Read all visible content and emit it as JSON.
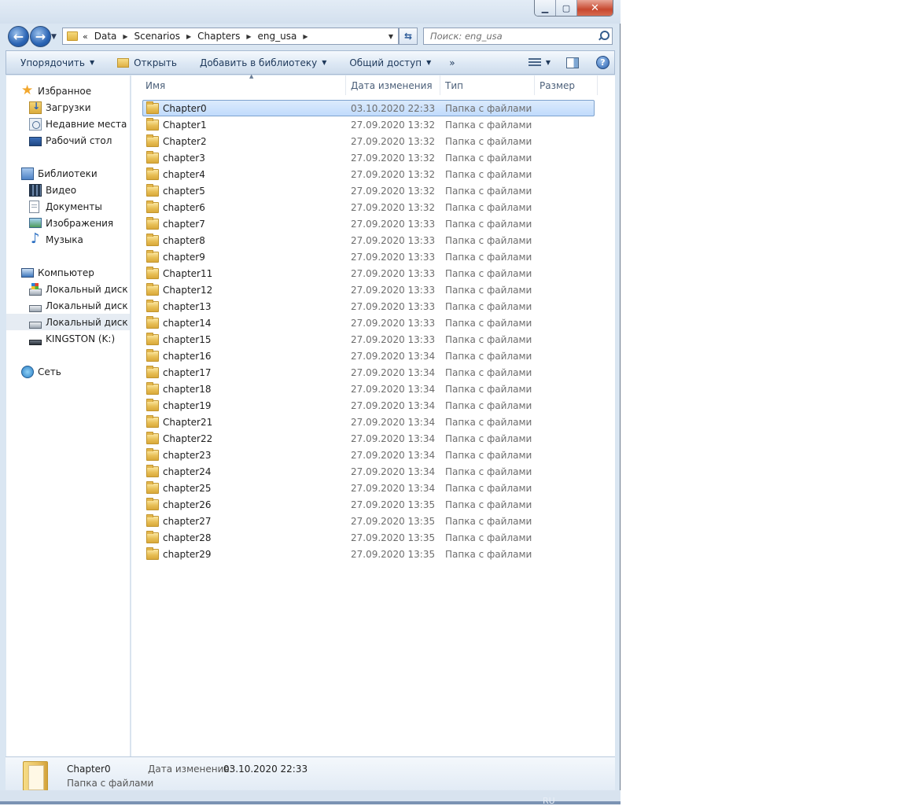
{
  "window": {
    "controls": {
      "minimize": "▁",
      "maximize": "▢",
      "close": "✕"
    }
  },
  "navigation": {
    "back": "←",
    "forward": "→",
    "history": "▼",
    "address": {
      "overflow": "«",
      "crumbs": [
        "Data",
        "Scenarios",
        "Chapters",
        "eng_usa"
      ]
    },
    "refresh": "⇆",
    "search_placeholder": "Поиск: eng_usa"
  },
  "toolbar": {
    "organize": "Упорядочить",
    "open": "Открыть",
    "add_to_library": "Добавить в библиотеку",
    "share": "Общий доступ",
    "more": "»",
    "help": "?"
  },
  "sidebar": {
    "favorites": {
      "label": "Избранное",
      "items": [
        "Загрузки",
        "Недавние места",
        "Рабочий стол"
      ]
    },
    "libraries": {
      "label": "Библиотеки",
      "items": [
        "Видео",
        "Документы",
        "Изображения",
        "Музыка"
      ]
    },
    "computer": {
      "label": "Компьютер",
      "items": [
        "Локальный диск (C",
        "Локальный диск (D",
        "Локальный диск (E:",
        "KINGSTON (K:)"
      ]
    },
    "network": {
      "label": "Сеть"
    }
  },
  "columns": {
    "name": "Имя",
    "date": "Дата изменения",
    "type": "Тип",
    "size": "Размер"
  },
  "files": [
    {
      "name": "Chapter0",
      "date": "03.10.2020 22:33",
      "type": "Папка с файлами"
    },
    {
      "name": "Chapter1",
      "date": "27.09.2020 13:32",
      "type": "Папка с файлами"
    },
    {
      "name": "Chapter2",
      "date": "27.09.2020 13:32",
      "type": "Папка с файлами"
    },
    {
      "name": "chapter3",
      "date": "27.09.2020 13:32",
      "type": "Папка с файлами"
    },
    {
      "name": "chapter4",
      "date": "27.09.2020 13:32",
      "type": "Папка с файлами"
    },
    {
      "name": "chapter5",
      "date": "27.09.2020 13:32",
      "type": "Папка с файлами"
    },
    {
      "name": "chapter6",
      "date": "27.09.2020 13:32",
      "type": "Папка с файлами"
    },
    {
      "name": "chapter7",
      "date": "27.09.2020 13:33",
      "type": "Папка с файлами"
    },
    {
      "name": "chapter8",
      "date": "27.09.2020 13:33",
      "type": "Папка с файлами"
    },
    {
      "name": "chapter9",
      "date": "27.09.2020 13:33",
      "type": "Папка с файлами"
    },
    {
      "name": "Chapter11",
      "date": "27.09.2020 13:33",
      "type": "Папка с файлами"
    },
    {
      "name": "Chapter12",
      "date": "27.09.2020 13:33",
      "type": "Папка с файлами"
    },
    {
      "name": "chapter13",
      "date": "27.09.2020 13:33",
      "type": "Папка с файлами"
    },
    {
      "name": "chapter14",
      "date": "27.09.2020 13:33",
      "type": "Папка с файлами"
    },
    {
      "name": "chapter15",
      "date": "27.09.2020 13:33",
      "type": "Папка с файлами"
    },
    {
      "name": "chapter16",
      "date": "27.09.2020 13:34",
      "type": "Папка с файлами"
    },
    {
      "name": "chapter17",
      "date": "27.09.2020 13:34",
      "type": "Папка с файлами"
    },
    {
      "name": "chapter18",
      "date": "27.09.2020 13:34",
      "type": "Папка с файлами"
    },
    {
      "name": "chapter19",
      "date": "27.09.2020 13:34",
      "type": "Папка с файлами"
    },
    {
      "name": "Chapter21",
      "date": "27.09.2020 13:34",
      "type": "Папка с файлами"
    },
    {
      "name": "Chapter22",
      "date": "27.09.2020 13:34",
      "type": "Папка с файлами"
    },
    {
      "name": "chapter23",
      "date": "27.09.2020 13:34",
      "type": "Папка с файлами"
    },
    {
      "name": "chapter24",
      "date": "27.09.2020 13:34",
      "type": "Папка с файлами"
    },
    {
      "name": "chapter25",
      "date": "27.09.2020 13:34",
      "type": "Папка с файлами"
    },
    {
      "name": "chapter26",
      "date": "27.09.2020 13:35",
      "type": "Папка с файлами"
    },
    {
      "name": "chapter27",
      "date": "27.09.2020 13:35",
      "type": "Папка с файлами"
    },
    {
      "name": "chapter28",
      "date": "27.09.2020 13:35",
      "type": "Папка с файлами"
    },
    {
      "name": "chapter29",
      "date": "27.09.2020 13:35",
      "type": "Папка с файлами"
    }
  ],
  "details": {
    "name": "Chapter0",
    "type": "Папка с файлами",
    "modified_label": "Дата изменения:",
    "modified_value": "03.10.2020 22:33"
  },
  "taskbar": {
    "lang": "RU"
  }
}
